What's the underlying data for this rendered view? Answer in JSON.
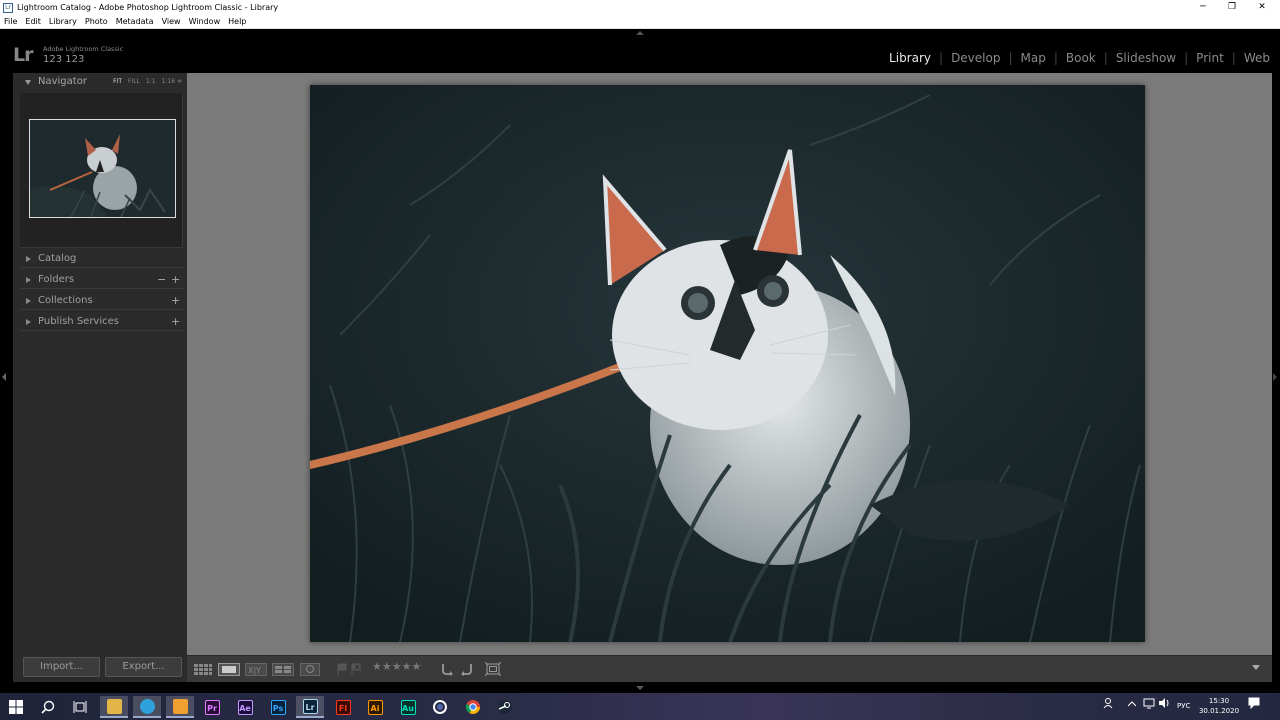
{
  "window": {
    "title": "Lightroom Catalog - Adobe Photoshop Lightroom Classic - Library",
    "app_icon": "Lr",
    "controls": [
      "minimize-icon",
      "restore-icon",
      "close-icon"
    ]
  },
  "menu": [
    "File",
    "Edit",
    "Library",
    "Photo",
    "Metadata",
    "View",
    "Window",
    "Help"
  ],
  "identity": {
    "logo": "Lr",
    "product": "Adobe Lightroom Classic",
    "user": "123 123"
  },
  "modules": [
    {
      "label": "Library",
      "active": true
    },
    {
      "label": "Develop",
      "active": false
    },
    {
      "label": "Map",
      "active": false
    },
    {
      "label": "Book",
      "active": false
    },
    {
      "label": "Slideshow",
      "active": false
    },
    {
      "label": "Print",
      "active": false
    },
    {
      "label": "Web",
      "active": false
    }
  ],
  "navigator": {
    "title": "Navigator",
    "zooms": [
      "FIT",
      "FILL",
      "1:1",
      "1:16 ≑"
    ]
  },
  "panels": [
    {
      "label": "Catalog",
      "controls": []
    },
    {
      "label": "Folders",
      "controls": [
        "−",
        "+"
      ]
    },
    {
      "label": "Collections",
      "controls": [
        "+"
      ]
    },
    {
      "label": "Publish Services",
      "controls": [
        "+"
      ]
    }
  ],
  "buttons": {
    "import": "Import...",
    "export": "Export..."
  },
  "toolbar": {
    "rating": "★★★★★",
    "view_modes": [
      "grid-view-icon",
      "loupe-view-icon",
      "compare-view-icon",
      "survey-view-icon",
      "people-view-icon"
    ],
    "flags": [
      "pick-flag-icon",
      "reject-flag-icon"
    ],
    "rotate": [
      "rotate-left-icon",
      "rotate-right-icon"
    ],
    "crop": "crop-overlay-icon"
  },
  "taskbar": {
    "apps": [
      {
        "name": "file-explorer-icon",
        "label": "",
        "bg": "#d8a93c",
        "fg": "#fff"
      },
      {
        "name": "telegram-icon",
        "label": "",
        "bg": "#2fa1da",
        "fg": "#fff"
      },
      {
        "name": "moment-app-icon",
        "label": "",
        "bg": "#f0a030",
        "fg": "#fff"
      },
      {
        "name": "premiere-icon",
        "label": "Pr",
        "bg": "#2a0e3a",
        "fg": "#e07cff"
      },
      {
        "name": "after-effects-icon",
        "label": "Ae",
        "bg": "#1c0e3a",
        "fg": "#c39bff"
      },
      {
        "name": "photoshop-icon",
        "label": "Ps",
        "bg": "#06213b",
        "fg": "#31a8ff"
      },
      {
        "name": "lightroom-icon",
        "label": "Lr",
        "bg": "#0c2238",
        "fg": "#add5ec"
      },
      {
        "name": "flash-icon",
        "label": "Fl",
        "bg": "#3a0a05",
        "fg": "#ff3a1c"
      },
      {
        "name": "illustrator-icon",
        "label": "Ai",
        "bg": "#2e1a02",
        "fg": "#ff9a00"
      },
      {
        "name": "audition-icon",
        "label": "Au",
        "bg": "#07302a",
        "fg": "#00e4bb"
      },
      {
        "name": "cortana-circle-icon",
        "label": "",
        "bg": "transparent",
        "fg": "#fff"
      },
      {
        "name": "chrome-icon",
        "label": "",
        "bg": "transparent",
        "fg": "#fff"
      },
      {
        "name": "steam-icon",
        "label": "",
        "bg": "transparent",
        "fg": "#fff"
      }
    ],
    "lang": "РУС",
    "time": "15:30",
    "date": "30.01.2020"
  }
}
